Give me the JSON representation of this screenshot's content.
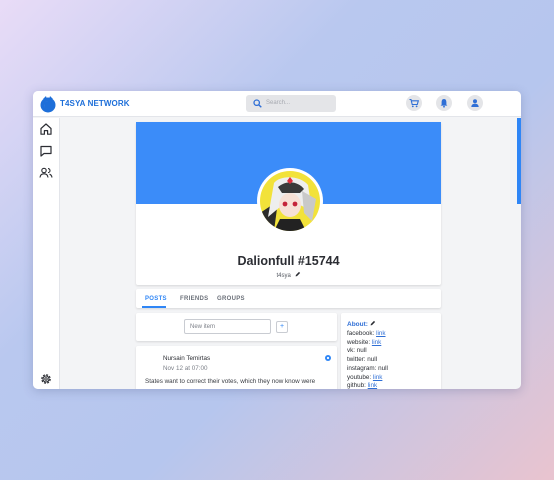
{
  "app": {
    "name": "T4SYA NETWORK",
    "brand_color": "#1e6fd9"
  },
  "search": {
    "placeholder": "Search..."
  },
  "topbar_icons": [
    "cart-icon",
    "bell-icon",
    "user-icon"
  ],
  "sidebar": {
    "items": [
      "home-icon",
      "chat-icon",
      "users-icon"
    ],
    "bottom": "gear-icon"
  },
  "profile": {
    "display_name": "Dalionfull #15744",
    "username": "t4sya",
    "banner_color": "#3b8cf9"
  },
  "tabs": [
    {
      "label": "POSTS"
    },
    {
      "label": "FRIENDS"
    },
    {
      "label": "GROUPS"
    }
  ],
  "new_item": {
    "placeholder": "New item",
    "add_label": "+"
  },
  "post": {
    "author": "Nursain Temirtas",
    "date": "Nov 12 at 07:00",
    "text": "States want to correct their votes, which they now know were"
  },
  "about": {
    "title": "About:",
    "rows": [
      {
        "key": "facebook:",
        "value": "link",
        "is_link": true
      },
      {
        "key": "website:",
        "value": "link",
        "is_link": true
      },
      {
        "key": "vk:",
        "value": "null",
        "is_link": false
      },
      {
        "key": "twitter:",
        "value": "null",
        "is_link": false
      },
      {
        "key": "instagram:",
        "value": "null",
        "is_link": false
      },
      {
        "key": "youtube:",
        "value": "link",
        "is_link": true
      },
      {
        "key": "github:",
        "value": "link",
        "is_link": true
      }
    ]
  }
}
